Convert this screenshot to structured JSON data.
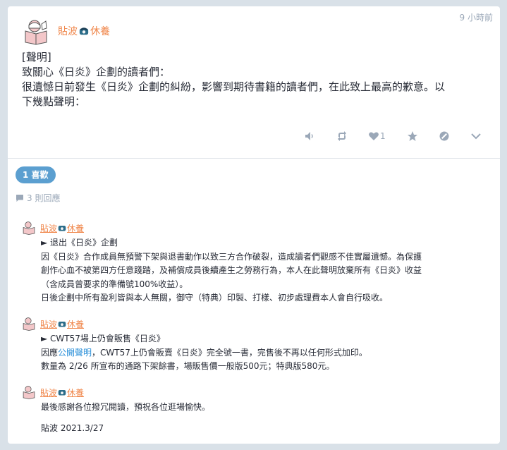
{
  "status": {
    "display_name": "貼波",
    "display_name_suffix": "休養",
    "time": "9 小時前",
    "content": [
      "[聲明]",
      "致關心《日炎》企劃的讀者們：",
      "很遺憾日前發生《日炎》企劃的糾紛，影響到期待書籍的讀者們，在此致上最高的歉意。以",
      "下幾點聲明："
    ],
    "actions": {
      "like_count": "1"
    }
  },
  "likes_badge": "1 喜歡",
  "reply_count": "3 則回應",
  "replies": [
    {
      "name": "貼波",
      "suffix": "休養",
      "lines": [
        "► 退出《日炎》企劃",
        "因《日炎》合作成員無預警下架與退書動作以致三方合作破裂，造成讀者們觀感不佳實屬遺憾。為保護",
        "創作心血不被第四方任意踐踏，及補償成員後續產生之勞務行為，本人在此聲明放棄所有《日炎》收益",
        "（含成員曾要求的準備號100%收益）。",
        "日後企劃中所有盈利皆與本人無關，御守（特典）印製、打樣、初步處理費本人會自行吸收。"
      ]
    },
    {
      "name": "貼波",
      "suffix": "休養",
      "line1": "► CWT57場上仍會販售《日炎》",
      "line2_pre": "因應",
      "line2_link": "公開聲明",
      "line2_post": "，CWT57上仍會販賣《日炎》完全號一書，完售後不再以任何形式加印。",
      "line3": "數量為 2/26 所宣布的通路下架餘書，場販售價一般版500元；特典版580元。"
    },
    {
      "name": "貼波",
      "suffix": "休養",
      "lines": [
        "最後感謝各位撥冗閱讀，預祝各位逛場愉快。"
      ],
      "signature": "貼波 2021.3/27"
    }
  ],
  "icons": {
    "avatar": "reading-girl-avatar",
    "phone": "telephone-emoji-icon",
    "actions": [
      "volume-icon",
      "retweet-icon",
      "heart-icon",
      "star-icon",
      "block-icon",
      "chevron-down-icon"
    ]
  }
}
